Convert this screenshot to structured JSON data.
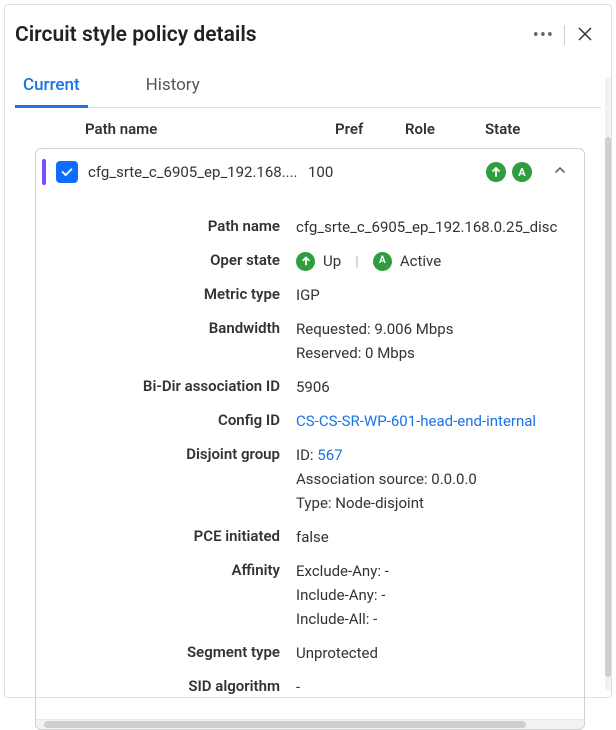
{
  "header": {
    "title": "Circuit style policy details"
  },
  "tabs": {
    "current": "Current",
    "history": "History"
  },
  "columns": {
    "path": "Path name",
    "pref": "Pref",
    "role": "Role",
    "state": "State"
  },
  "row": {
    "name": "cfg_srte_c_6905_ep_192.168....",
    "pref": "100"
  },
  "details": {
    "path_name_label": "Path name",
    "path_name": "cfg_srte_c_6905_ep_192.168.0.25_disc",
    "oper_state_label": "Oper state",
    "oper_up": "Up",
    "oper_active": "Active",
    "metric_type_label": "Metric type",
    "metric_type": "IGP",
    "bandwidth_label": "Bandwidth",
    "bandwidth_requested": "Requested: 9.006 Mbps",
    "bandwidth_reserved": "Reserved: 0 Mbps",
    "bidir_label": "Bi-Dir association ID",
    "bidir": "5906",
    "config_id_label": "Config ID",
    "config_id": "CS-CS-SR-WP-601-head-end-internal",
    "disjoint_label": "Disjoint group",
    "disjoint_id_prefix": "ID: ",
    "disjoint_id": "567",
    "disjoint_source": "Association source: 0.0.0.0",
    "disjoint_type": "Type: Node-disjoint",
    "pce_label": "PCE initiated",
    "pce": "false",
    "affinity_label": "Affinity",
    "affinity_exclude": "Exclude-Any: -",
    "affinity_include_any": "Include-Any: -",
    "affinity_include_all": "Include-All: -",
    "segment_label": "Segment type",
    "segment": "Unprotected",
    "sid_label": "SID algorithm",
    "sid": "-"
  },
  "icons": {
    "up_letter": "↑",
    "a_letter": "A"
  }
}
